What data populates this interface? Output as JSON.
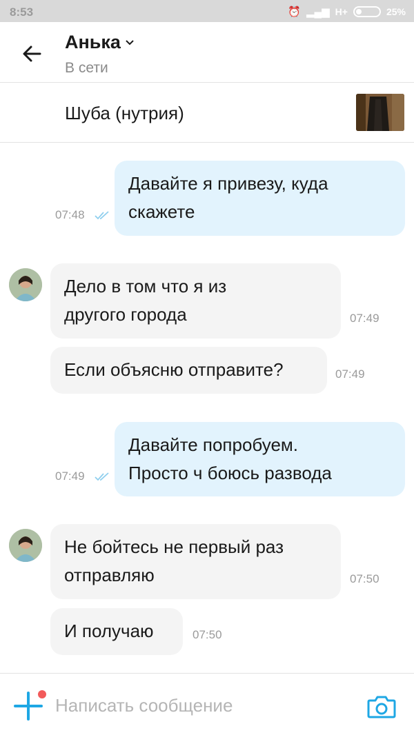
{
  "status_bar": {
    "time": "8:53",
    "network": "H+",
    "battery": "25%",
    "battery_level": 0.25
  },
  "header": {
    "contact_name": "Анька",
    "contact_status": "В сети"
  },
  "listing": {
    "title": "Шуба (нутрия)"
  },
  "messages": [
    {
      "direction": "outgoing",
      "lines": [
        "Давайте я привезу, куда",
        "скажете"
      ],
      "time": "07:48",
      "read": true
    },
    {
      "direction": "incoming",
      "lines": [
        "Дело в том что я из",
        "другого города"
      ],
      "time": "07:49"
    },
    {
      "direction": "incoming",
      "lines": [
        "Если объясню отправите?"
      ],
      "time": "07:49"
    },
    {
      "direction": "outgoing",
      "lines": [
        "Давайте попробуем.",
        "Просто ч боюсь развода"
      ],
      "time": "07:49",
      "read": true
    },
    {
      "direction": "incoming",
      "lines": [
        "Не бойтесь не первый раз",
        "отправляю"
      ],
      "time": "07:50"
    },
    {
      "direction": "incoming",
      "lines": [
        "И получаю"
      ],
      "time": "07:50"
    }
  ],
  "composer": {
    "placeholder": "Написать сообщение"
  },
  "colors": {
    "accent": "#1ea7e4",
    "outgoing_bubble": "#e2f3fd",
    "incoming_bubble": "#f4f4f4",
    "notification_dot": "#f25a5a"
  },
  "icons": {
    "back": "arrow-left-icon",
    "dropdown": "chevron-down-icon",
    "read_receipt": "double-check-icon",
    "attach": "plus-icon",
    "camera": "camera-icon"
  }
}
